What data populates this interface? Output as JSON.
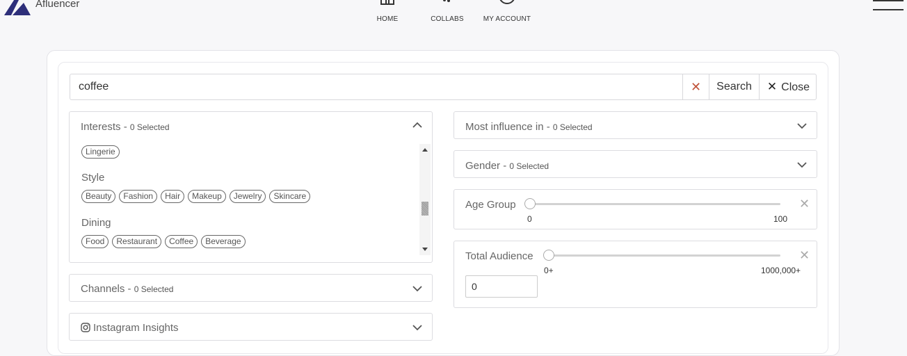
{
  "brand": {
    "name": "Afluencer"
  },
  "nav": [
    {
      "label": "HOME",
      "icon": "home-icon"
    },
    {
      "label": "COLLABS",
      "icon": "handshake-icon"
    },
    {
      "label": "MY ACCOUNT",
      "icon": "user-icon"
    }
  ],
  "search": {
    "value": "coffee",
    "clear": "✕",
    "search_label": "Search",
    "close_label": "Close",
    "close_icon": "✕"
  },
  "interests": {
    "title": "Interests - ",
    "selected": "0 Selected",
    "groups": [
      {
        "name": "",
        "tags": [
          "Lingerie"
        ]
      },
      {
        "name": "Style",
        "tags": [
          "Beauty",
          "Fashion",
          "Hair",
          "Makeup",
          "Jewelry",
          "Skincare"
        ]
      },
      {
        "name": "Dining",
        "tags": [
          "Food",
          "Restaurant",
          "Coffee",
          "Beverage"
        ]
      }
    ]
  },
  "channels": {
    "title": "Channels - ",
    "selected": "0 Selected"
  },
  "instagram": {
    "title": "Instagram Insights",
    "icon": "instagram-icon"
  },
  "influence": {
    "title": "Most influence in - ",
    "selected": "0 Selected"
  },
  "gender": {
    "title": "Gender - ",
    "selected": "0 Selected"
  },
  "age": {
    "title": "Age Group",
    "min_label": "0",
    "max_label": "100",
    "value": 0
  },
  "audience": {
    "title": "Total Audience",
    "min_label": "0+",
    "max_label": "1000,000+",
    "input_value": "0",
    "value": 0
  },
  "colors": {
    "brand": "#2e2f7a",
    "clear_x": "#c0533a"
  }
}
